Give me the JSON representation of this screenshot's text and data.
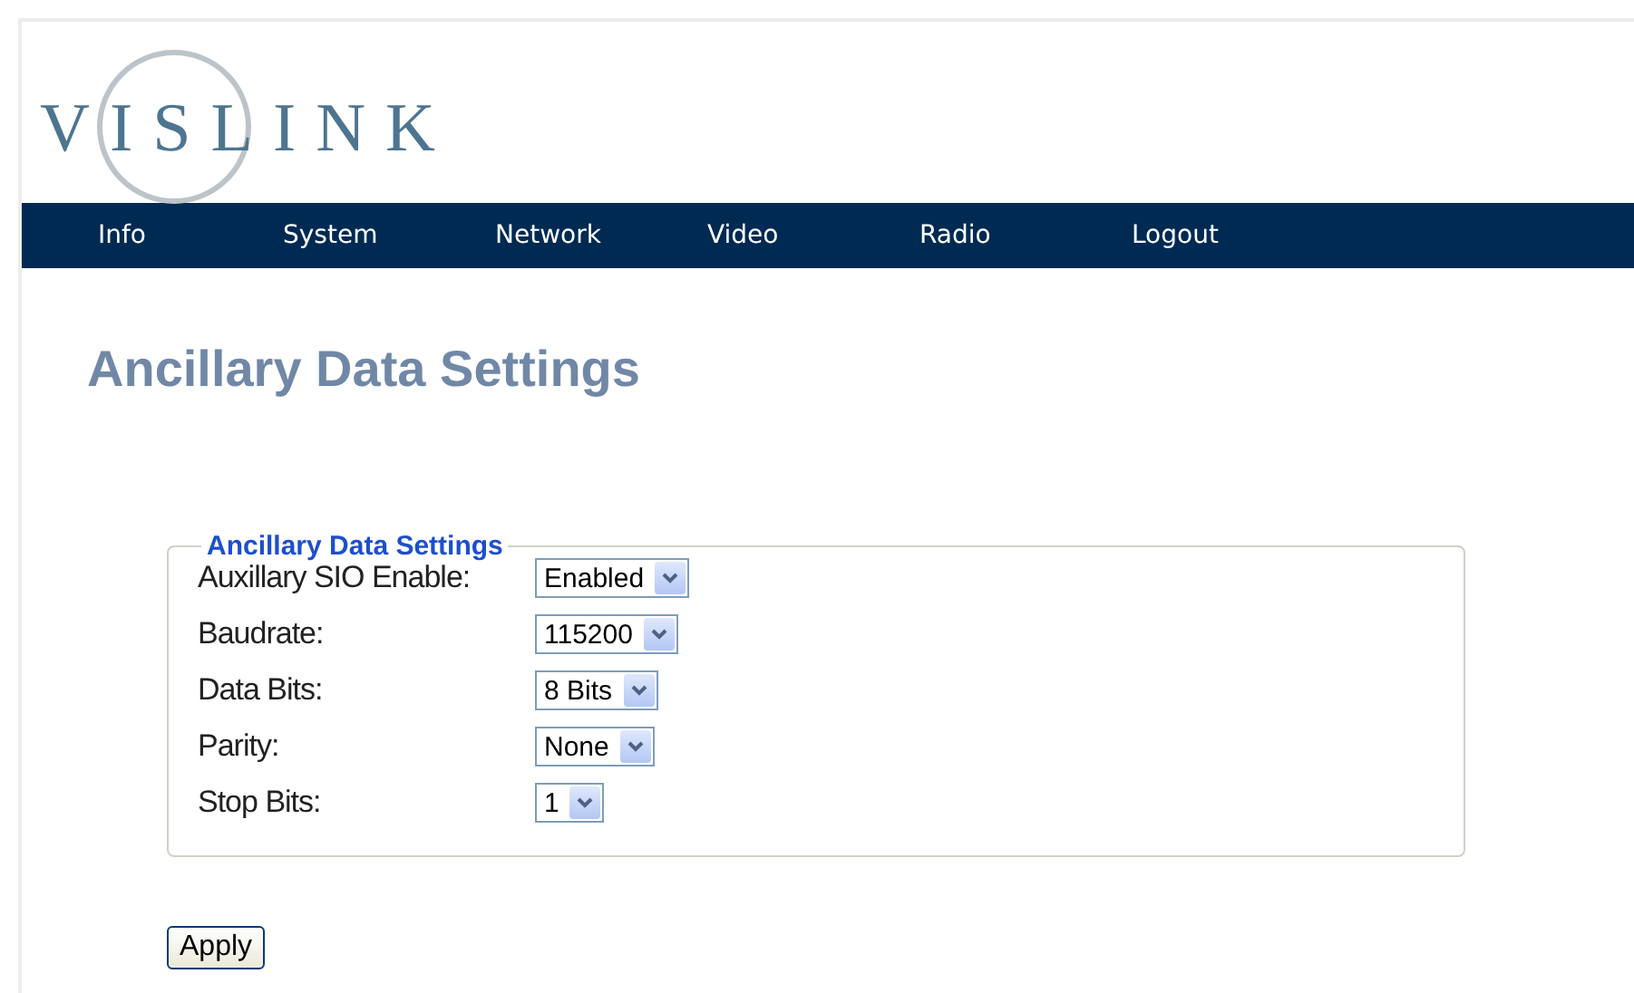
{
  "logo": {
    "text": "VISLINK"
  },
  "nav": [
    {
      "label": "Info"
    },
    {
      "label": "System"
    },
    {
      "label": "Network"
    },
    {
      "label": "Video"
    },
    {
      "label": "Radio"
    },
    {
      "label": "Logout"
    }
  ],
  "page_title": "Ancillary Data Settings",
  "fieldset": {
    "legend": "Ancillary Data Settings",
    "fields": [
      {
        "label": "Auxillary SIO Enable:",
        "value": "Enabled"
      },
      {
        "label": "Baudrate:",
        "value": "115200"
      },
      {
        "label": "Data Bits:",
        "value": "8 Bits"
      },
      {
        "label": "Parity:",
        "value": "None"
      },
      {
        "label": "Stop Bits:",
        "value": "1"
      }
    ]
  },
  "buttons": [
    {
      "label": "Apply"
    }
  ]
}
